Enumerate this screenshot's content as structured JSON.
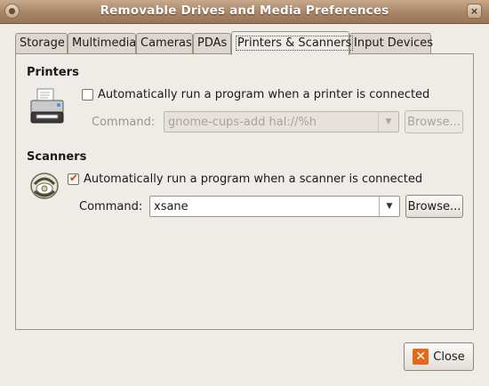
{
  "window": {
    "title": "Removable Drives and Media Preferences",
    "close_glyph": "×"
  },
  "tabs": [
    {
      "label": "Storage",
      "active": false
    },
    {
      "label": "Multimedia",
      "active": false
    },
    {
      "label": "Cameras",
      "active": false
    },
    {
      "label": "PDAs",
      "active": false
    },
    {
      "label": "Printers & Scanners",
      "active": true
    },
    {
      "label": "Input Devices",
      "active": false
    }
  ],
  "printers": {
    "section_title": "Printers",
    "icon": "printer-icon",
    "auto_run_label": "Automatically run a program when a printer is connected",
    "auto_run_checked": false,
    "command_label": "Command:",
    "command_value": "gnome-cups-add hal://%h",
    "browse_label": "Browse...",
    "enabled": false
  },
  "scanners": {
    "section_title": "Scanners",
    "icon": "scanner-icon",
    "auto_run_label": "Automatically run a program when a scanner is connected",
    "auto_run_checked": true,
    "command_label": "Command:",
    "command_value": "xsane",
    "browse_label": "Browse...",
    "enabled": true
  },
  "footer": {
    "close_label": "Close",
    "close_icon_glyph": "✕"
  },
  "colors": {
    "titlebar": "#a88466",
    "accent": "#e46a1b",
    "background": "#efebe7"
  }
}
